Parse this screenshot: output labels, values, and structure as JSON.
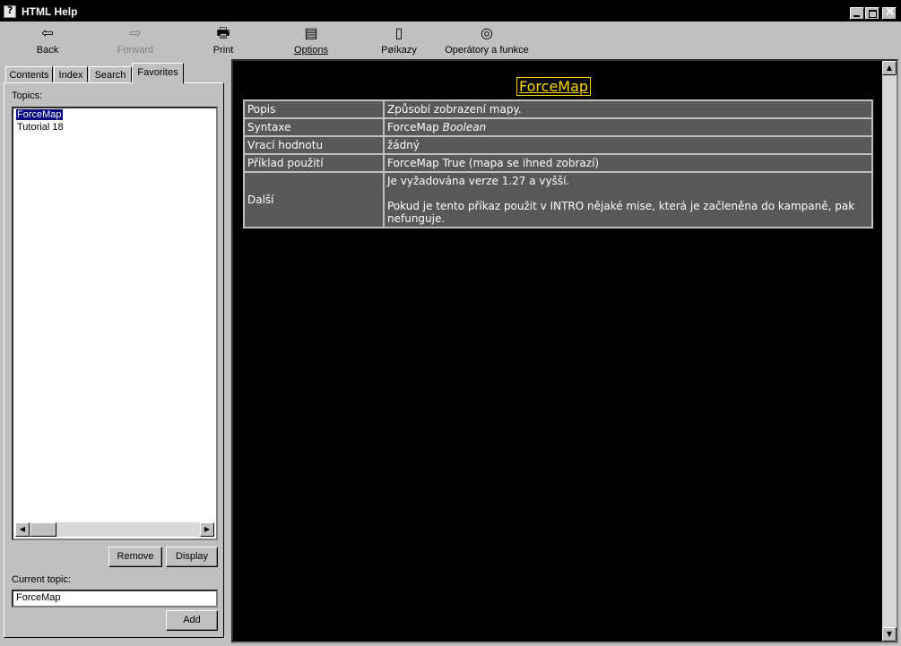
{
  "window": {
    "title": "HTML Help"
  },
  "toolbar": {
    "back": "Back",
    "forward": "Forward",
    "print": "Print",
    "options": "Options",
    "prikazy": "Pøíkazy",
    "operatory": "Operátory a funkce"
  },
  "tabs": {
    "contents": "Contents",
    "index": "Index",
    "search": "Search",
    "favorites": "Favorites"
  },
  "favorites": {
    "topics_label": "Topics:",
    "topics": [
      "ForceMap",
      "Tutorial 18"
    ],
    "selected": "ForceMap",
    "remove": "Remove",
    "display": "Display",
    "current_label": "Current topic:",
    "current_value": "ForceMap",
    "add": "Add"
  },
  "doc": {
    "title": "ForceMap",
    "rows": {
      "popis": {
        "label": "Popis",
        "value": "Způsobí zobrazení mapy."
      },
      "syntaxe": {
        "label": "Syntaxe",
        "value": "ForceMap ",
        "param": "Boolean"
      },
      "vraci": {
        "label": "Vrací hodnotu",
        "value": "žádný"
      },
      "priklad": {
        "label": "Příklad použití",
        "value": "ForceMap True (mapa se ihned zobrazí)"
      },
      "dalsi": {
        "label": "Další",
        "value1": "Je vyžadována verze 1.27 a vyšší.",
        "value2": "Pokud je tento příkaz použit v INTRO nějaké mise, která je začleněna do kampaně, pak nefunguje."
      }
    }
  },
  "colors": {
    "content_bg": "#000000",
    "cell_bg": "#585858",
    "title": "#ffd700",
    "selection": "#000080"
  }
}
